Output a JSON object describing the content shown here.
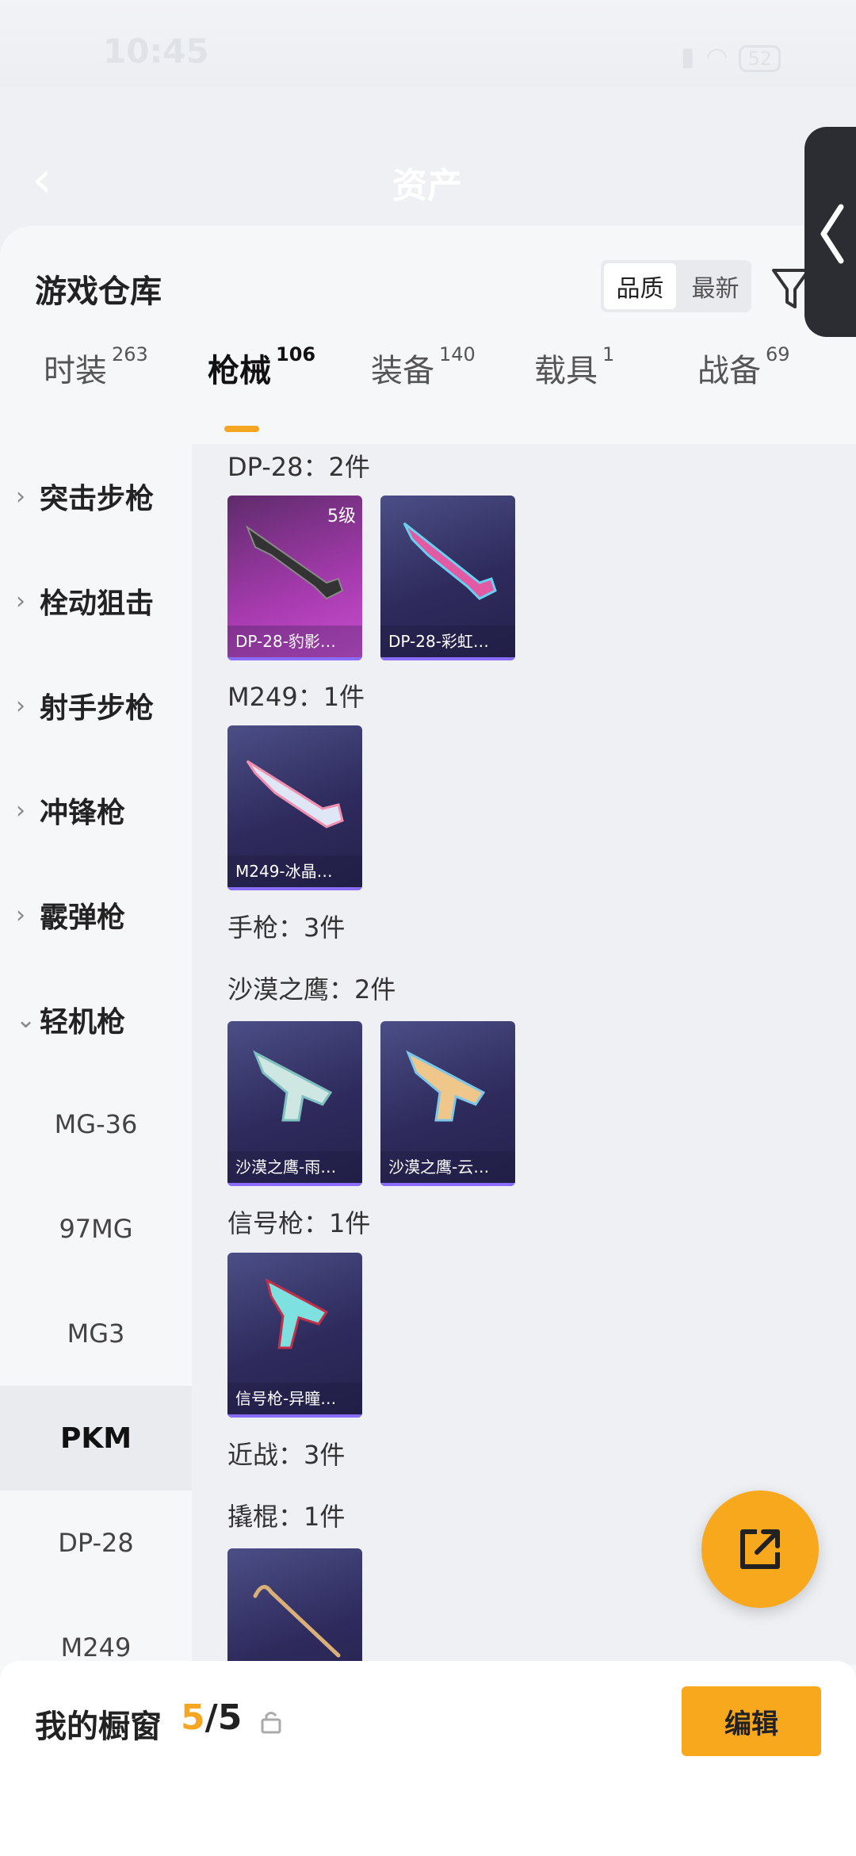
{
  "status": {
    "time": "10:45",
    "battery": "52"
  },
  "header": {
    "title": "资产"
  },
  "panel": {
    "title": "游戏仓库",
    "sort": {
      "quality": "品质",
      "newest": "最新"
    }
  },
  "tabs": [
    {
      "label": "时装",
      "count": "263"
    },
    {
      "label": "枪械",
      "count": "106"
    },
    {
      "label": "装备",
      "count": "140"
    },
    {
      "label": "载具",
      "count": "1"
    },
    {
      "label": "战备",
      "count": "69"
    }
  ],
  "categories": [
    {
      "label": "突击步枪"
    },
    {
      "label": "栓动狙击"
    },
    {
      "label": "射手步枪"
    },
    {
      "label": "冲锋枪"
    },
    {
      "label": "霰弹枪"
    },
    {
      "label": "轻机枪"
    }
  ],
  "subcategories": [
    {
      "label": "MG-36"
    },
    {
      "label": "97MG"
    },
    {
      "label": "MG3"
    },
    {
      "label": "PKM"
    },
    {
      "label": "DP-28"
    },
    {
      "label": "M249"
    }
  ],
  "content": {
    "sections": [
      {
        "label": "DP-28：2件"
      },
      {
        "label": "M249：1件"
      },
      {
        "label": "手枪：3件"
      },
      {
        "label": "沙漠之鹰：2件"
      },
      {
        "label": "信号枪：1件"
      },
      {
        "label": "近战：3件"
      },
      {
        "label": "撬棍：1件"
      }
    ],
    "items": [
      {
        "name": "DP-28-豹影…",
        "level": "5级"
      },
      {
        "name": "DP-28-彩虹…"
      },
      {
        "name": "M249-冰晶…"
      },
      {
        "name": "沙漠之鹰-雨…"
      },
      {
        "name": "沙漠之鹰-云…"
      },
      {
        "name": "信号枪-异瞳…"
      },
      {
        "name": ""
      }
    ]
  },
  "bottom": {
    "title": "我的橱窗",
    "count_current": "5",
    "count_total": "/5",
    "edit_label": "编辑"
  },
  "colors": {
    "accent": "#f7a81c",
    "card": "#2e2a5c",
    "card_gold": "#a83bb0"
  }
}
